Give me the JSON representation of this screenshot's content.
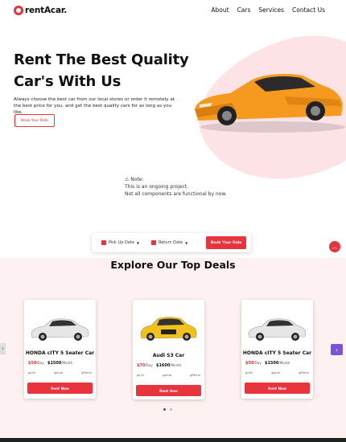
{
  "brand": {
    "logo_text": "rentAcar."
  },
  "nav": {
    "items": [
      {
        "label": "About"
      },
      {
        "label": "Cars"
      },
      {
        "label": "Services"
      },
      {
        "label": "Contact Us"
      }
    ]
  },
  "hero": {
    "title_line1": "Rent The Best Quality",
    "title_line2": "Car's With Us",
    "description": "Always choose the best car from our local stores or order it remotely at the best price for you, and get the best quality cars for as long as you like.",
    "cta_label": "Book Your Ride"
  },
  "note": {
    "heading": "⚠ Note:",
    "line1": "This is an ongoing project.",
    "line2": "Not all components are functional by now."
  },
  "booking": {
    "pickup_label": "Pick Up Date",
    "return_label": "Return Date",
    "button_label": "Book Your Ride"
  },
  "deals": {
    "title": "Explore Our Top Deals",
    "cards": [
      {
        "name": "HONDA cITY 5 Seater Car",
        "price_day": "$50",
        "per_day": "/Day",
        "price_month": "$1500",
        "per_month": "/Month",
        "mileage": "20k",
        "transmission": "Auto",
        "fuel": "Petrol",
        "button": "Rent Now",
        "color": "#e6e6e6"
      },
      {
        "name": "Audi S3 Car",
        "price_day": "$70",
        "per_day": "/Day",
        "price_month": "$1600",
        "per_month": "/Month",
        "mileage": "11k",
        "transmission": "Auto",
        "fuel": "Petrol",
        "button": "Rent Now",
        "color": "#f2c21b"
      },
      {
        "name": "HONDA cITY 5 Seater Car",
        "price_day": "$50",
        "per_day": "/Day",
        "price_month": "$1500",
        "per_month": "/Month",
        "mileage": "20k",
        "transmission": "Auto",
        "fuel": "Petrol",
        "button": "Rent Now",
        "color": "#e6e6e6"
      }
    ]
  },
  "colors": {
    "accent": "#e8343d",
    "hero_car": "#f59a1e",
    "pink_bg": "#fde3e6",
    "next_arrow": "#7a52d8"
  }
}
